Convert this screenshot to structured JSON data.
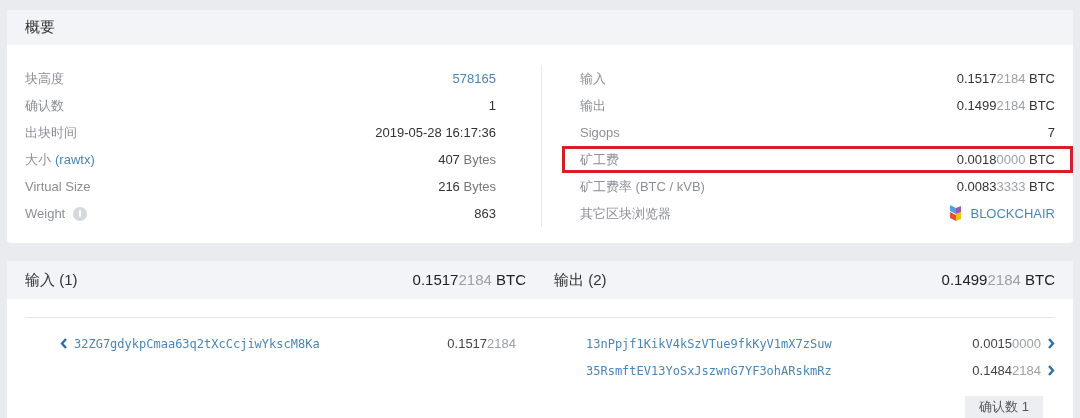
{
  "summary": {
    "title": "概要",
    "left_rows": [
      {
        "label": "块高度",
        "kind": "link",
        "value": "578165"
      },
      {
        "label": "确认数",
        "kind": "text",
        "value": "1"
      },
      {
        "label": "出块时间",
        "kind": "text",
        "value": "2019-05-28 16:17:36"
      },
      {
        "label": "大小",
        "label_link": "(rawtx)",
        "kind": "bytes",
        "value": "407",
        "unit": "Bytes"
      },
      {
        "label": "Virtual Size",
        "kind": "bytes",
        "value": "216",
        "unit": "Bytes"
      },
      {
        "label": "Weight",
        "info": true,
        "kind": "text",
        "value": "863"
      }
    ],
    "right_rows": [
      {
        "label": "输入",
        "kind": "amount",
        "value": "0.15172184 BTC",
        "highlighted": false
      },
      {
        "label": "输出",
        "kind": "amount",
        "value": "0.14992184 BTC",
        "highlighted": false
      },
      {
        "label": "Sigops",
        "kind": "text",
        "value": "7",
        "highlighted": false
      },
      {
        "label": "矿工费",
        "kind": "amount",
        "value": "0.00180000 BTC",
        "highlighted": true
      },
      {
        "label": "矿工费率 (BTC / kVB)",
        "kind": "amount",
        "value": "0.00833333 BTC",
        "highlighted": false
      },
      {
        "label": "其它区块浏览器",
        "kind": "explorer",
        "value": "BLOCKCHAIR",
        "highlighted": false
      }
    ]
  },
  "transfers": {
    "inputs": {
      "title": "输入 (1)",
      "total": "0.15172184 BTC",
      "rows": [
        {
          "address": "32ZG7gdykpCmaa63q2tXcCcjiwYkscM8Ka",
          "amount": "0.15172184"
        }
      ]
    },
    "outputs": {
      "title": "输出 (2)",
      "total": "0.14992184 BTC",
      "rows": [
        {
          "address": "13nPpjf1KikV4kSzVTue9fkKyV1mX7zSuw",
          "amount": "0.00150000"
        },
        {
          "address": "35RsmftEV13YoSxJszwnG7YF3ohARskmRz",
          "amount": "0.14842184"
        }
      ]
    },
    "confirmations_badge": "确认数 1"
  }
}
